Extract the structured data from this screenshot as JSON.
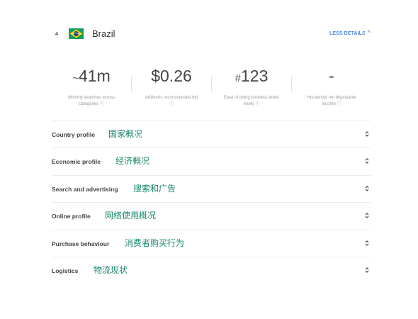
{
  "header": {
    "rank": "4",
    "flag": "brazil-flag",
    "country": "Brazil",
    "less_details": "LESS DETAILS",
    "colors": {
      "accent": "#4a86e8",
      "annotation": "#1a8a6e"
    }
  },
  "stats": [
    {
      "prefix": "~",
      "value": "41m",
      "label": "Monthly searches across categories ⓘ"
    },
    {
      "prefix": "",
      "value": "$0.26",
      "label": "AdWords recommended bid ⓘ"
    },
    {
      "prefix": "#",
      "value": "123",
      "label": "Ease of doing business index (rank) ⓘ"
    },
    {
      "prefix": "",
      "value": "-",
      "label": "Household net disposable income ⓘ"
    }
  ],
  "sections": [
    {
      "label": "Country profile",
      "annotation": "国家概况"
    },
    {
      "label": "Economic profile",
      "annotation": "经济概况"
    },
    {
      "label": "Search and advertising",
      "annotation": "搜索和广告"
    },
    {
      "label": "Online profile",
      "annotation": "网络使用概况"
    },
    {
      "label": "Purchase behaviour",
      "annotation": "消费者购买行为"
    },
    {
      "label": "Logistics",
      "annotation": "物流现状"
    }
  ]
}
